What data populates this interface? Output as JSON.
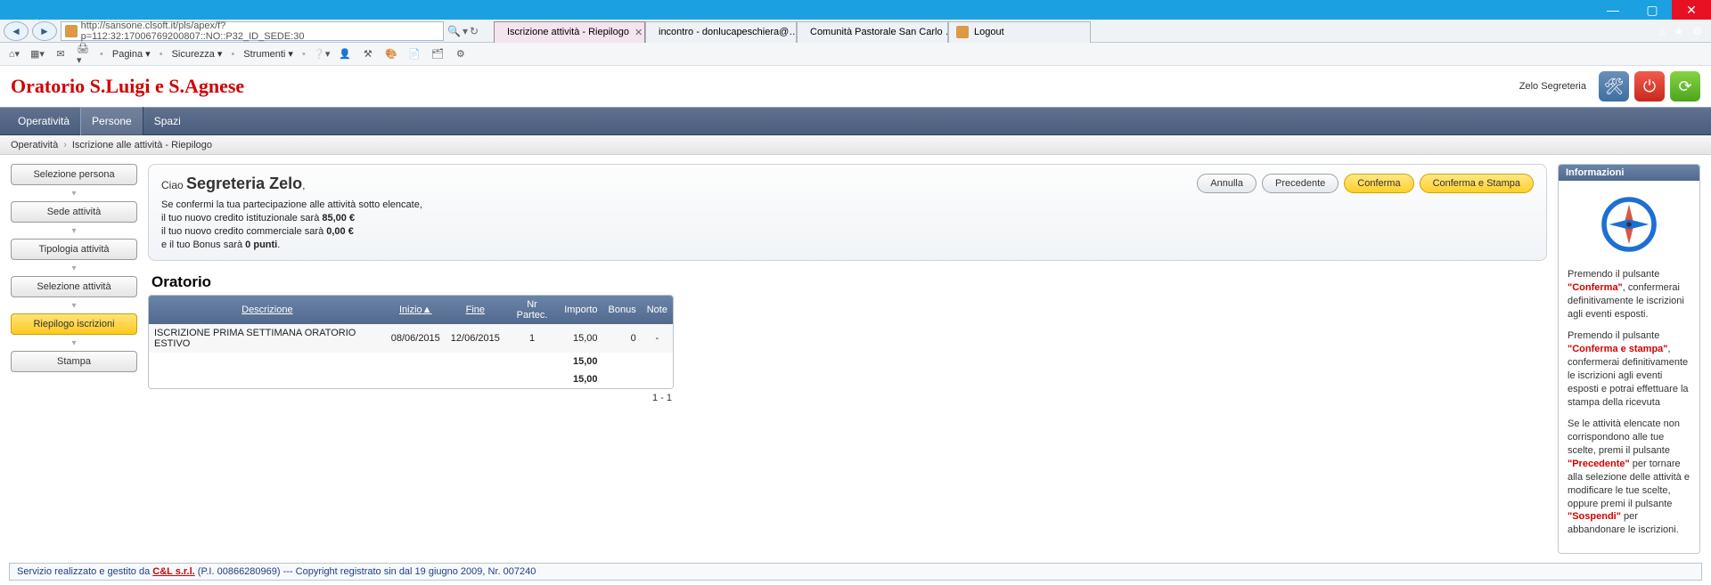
{
  "window": {
    "minimize": "—",
    "maximize": "▢",
    "close": "✕"
  },
  "ie": {
    "url": "http://sansone.clsoft.it/pls/apex/f?p=112:32:17006769200807::NO::P32_ID_SEDE:30",
    "search_icon": "🔍",
    "tabs": [
      {
        "label": "Iscrizione attività - Riepilogo",
        "icon_color": "#d94",
        "active": true,
        "close": "✕"
      },
      {
        "label": "incontro - donlucapeschiera@…",
        "icon_color": "#d54",
        "active": false
      },
      {
        "label": "Comunità Pastorale San Carlo …",
        "icon_color": "#d54",
        "active": false
      },
      {
        "label": "Logout",
        "icon_color": "#d94",
        "active": false
      }
    ],
    "right_icons": [
      "⌂",
      "★",
      "⚙"
    ],
    "menu": [
      "Pagina",
      "Sicurezza",
      "Strumenti"
    ]
  },
  "header": {
    "title": "Oratorio S.Luigi e S.Agnese",
    "user": "Zelo Segreteria",
    "btn_tools": "🛠",
    "btn_power": "⏻",
    "btn_refresh": "⟳"
  },
  "nav": {
    "items": [
      "Operatività",
      "Persone",
      "Spazi"
    ],
    "active": 1
  },
  "breadcrumb": {
    "a": "Operatività",
    "b": "Iscrizione alle attività - Riepilogo"
  },
  "sidebar": {
    "steps": [
      "Selezione persona",
      "Sede attività",
      "Tipologia attività",
      "Selezione attività",
      "Riepilogo iscrizioni",
      "Stampa"
    ],
    "active": 4,
    "down": "▾"
  },
  "greeting": {
    "hello": "Ciao",
    "name": "Segreteria Zelo"
  },
  "msg": {
    "l1": "Se confermi la tua partecipazione alle attività sotto elencate,",
    "l2_a": "il tuo nuovo credito istituzionale sarà ",
    "l2_b": "85,00 €",
    "l3_a": "il tuo nuovo credito commerciale sarà ",
    "l3_b": "0,00 €",
    "l4_a": "e il tuo Bonus sarà ",
    "l4_b": "0 punti",
    "l4_c": "."
  },
  "actions": {
    "cancel": "Annulla",
    "prev": "Precedente",
    "confirm": "Conferma",
    "confirm_print": "Conferma e Stampa"
  },
  "table": {
    "title": "Oratorio",
    "cols": {
      "descr": "Descrizione",
      "inizio": "Inizio",
      "sort": "▲",
      "fine": "Fine",
      "partec": "Nr Partec.",
      "importo": "Importo",
      "bonus": "Bonus",
      "note": "Note"
    },
    "row": {
      "descr": "ISCRIZIONE PRIMA SETTIMANA ORATORIO ESTIVO",
      "inizio": "08/06/2015",
      "fine": "12/06/2015",
      "partec": "1",
      "importo": "15,00",
      "bonus": "0",
      "note": "-"
    },
    "sum1": "15,00",
    "sum2": "15,00",
    "pager": "1 - 1"
  },
  "info": {
    "title": "Informazioni",
    "p1_a": "Premendo il pulsante ",
    "p1_b": "\"Conferma\"",
    "p1_c": ", confermerai definitivamente le iscrizioni agli eventi esposti.",
    "p2_a": "Premendo il pulsante ",
    "p2_b": "\"Conferma e stampa\"",
    "p2_c": ", confermerai definitivamente le iscrizioni agli eventi esposti e potrai effettuare la stampa della ricevuta",
    "p3_a": "Se le attività elencate non corrispondono alle tue scelte, premi il pulsante ",
    "p3_b": "\"Precedente\"",
    "p3_c": " per tornare alla selezione delle attività e modificare le tue scelte, oppure premi il pulsante ",
    "p3_d": "\"Sospendi\"",
    "p3_e": " per abbandonare le iscrizioni."
  },
  "footer": {
    "a": "Servizio realizzato e gestito da ",
    "b": "C&L s.r.l.",
    "c": " (P.I. 00866280969) --- Copyright registrato sin dal 19 giugno 2009, Nr. 007240"
  }
}
